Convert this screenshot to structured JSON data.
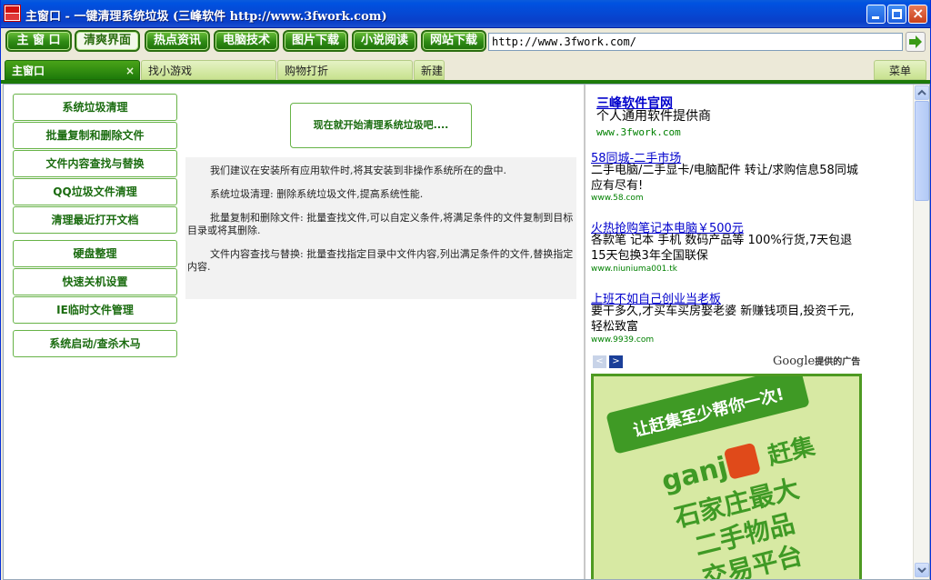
{
  "window": {
    "title": "主窗口 - 一键清理系统垃圾 (三峰软件 http://www.3fwork.com)"
  },
  "toolbar": {
    "buttons": [
      {
        "label": "主 窗 口"
      },
      {
        "label": "清爽界面"
      },
      {
        "label": "热点资讯"
      },
      {
        "label": "电脑技术"
      },
      {
        "label": "图片下载"
      },
      {
        "label": "小说阅读"
      },
      {
        "label": "网站下载"
      }
    ],
    "address": "http://www.3fwork.com/"
  },
  "tabs": [
    {
      "label": "主窗口",
      "close": "×"
    },
    {
      "label": "找小游戏"
    },
    {
      "label": "购物打折"
    },
    {
      "label": "新建"
    }
  ],
  "menu_tab": "菜单",
  "sidebar": {
    "buttons": [
      {
        "label": "系统垃圾清理"
      },
      {
        "label": "批量复制和删除文件"
      },
      {
        "label": "文件内容查找与替换"
      },
      {
        "label": "QQ垃圾文件清理"
      },
      {
        "label": "清理最近打开文档"
      },
      {
        "label": "硬盘整理"
      },
      {
        "label": "快速关机设置"
      },
      {
        "label": "IE临时文件管理"
      },
      {
        "label": "系统启动/查杀木马"
      }
    ]
  },
  "main": {
    "start_label": "现在就开始清理系统垃圾吧....",
    "paragraphs": [
      "我们建议在安装所有应用软件时,将其安装到非操作系统所在的盘中.",
      "系统垃圾清理: 删除系统垃圾文件,提高系统性能.",
      "批量复制和删除文件: 批量查找文件,可以自定义条件,将满足条件的文件复制到目标目录或将其删除.",
      "文件内容查找与替换: 批量查找指定目录中文件内容,列出满足条件的文件,替换指定内容."
    ]
  },
  "ads": {
    "featured": {
      "title": "三峰软件官网",
      "desc": "个人通用软件提供商",
      "url": "www.3fwork.com"
    },
    "items": [
      {
        "title": "58同城-二手市场",
        "desc": "二手电脑/二手显卡/电脑配件 转让/求购信息58同城应有尽有!",
        "url": "www.58.com"
      },
      {
        "title": "火热抢购笔记本电脑￥500元",
        "desc": "各款笔 记本 手机 数码产品等 100%行货,7天包退15天包换3年全国联保",
        "url": "www.niuniuma001.tk"
      },
      {
        "title": "上班不如自己创业当老板",
        "desc": "要干多久,才买车买房娶老婆 新赚钱项目,投资千元,轻松致富",
        "url": "www.9939.com"
      }
    ],
    "nav_prev": "<",
    "nav_next": ">",
    "google_word": "Google",
    "google_suffix": "提供的广告",
    "banner": {
      "slogan": "让赶集至少帮你一次!",
      "brand_latin": "ganji",
      "brand_cn": "赶集",
      "lines": [
        "石家庄最大",
        "二手物品",
        "交易平台"
      ]
    }
  },
  "colors": {
    "titlebar": "#0a3fc8",
    "nav_green": "#2e8a14",
    "side_text": "#1b6c10",
    "ad_link": "#0000cc",
    "ad_url": "#008000"
  }
}
